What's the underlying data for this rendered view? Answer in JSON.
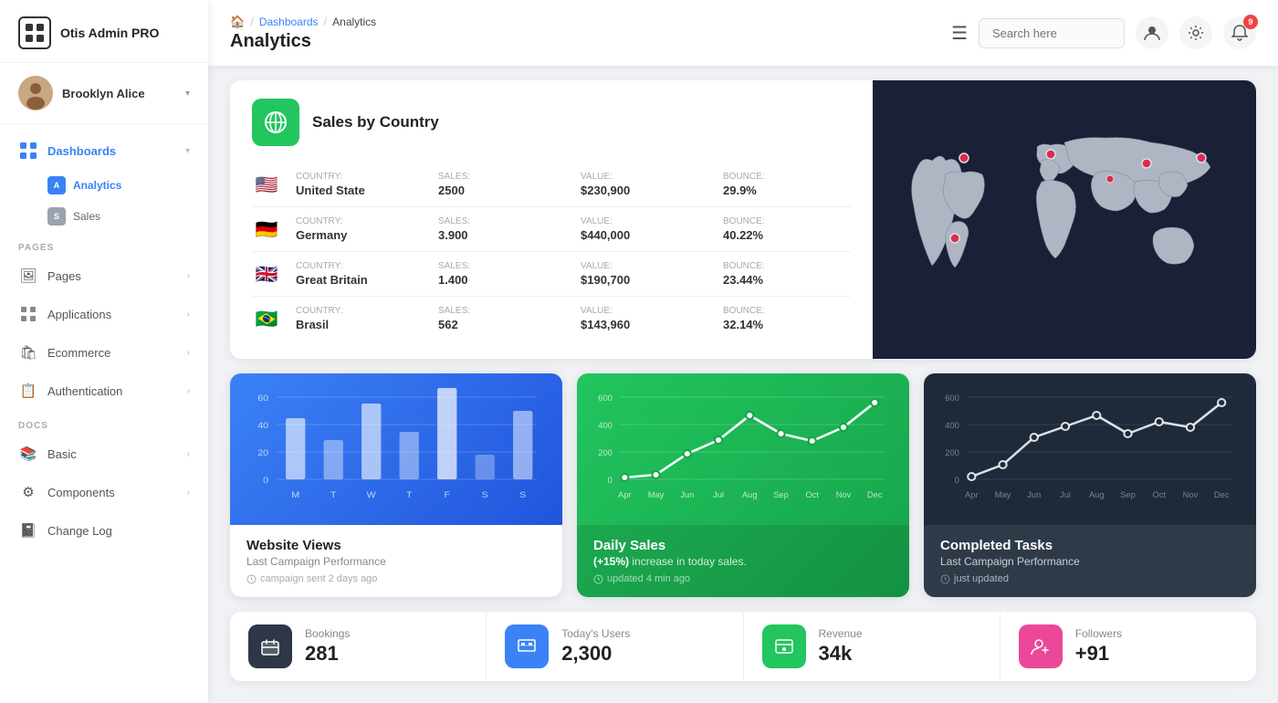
{
  "app": {
    "name": "Otis Admin PRO"
  },
  "user": {
    "name": "Brooklyn Alice"
  },
  "header": {
    "breadcrumb": {
      "home": "🏠",
      "separator1": "/",
      "dashboards": "Dashboards",
      "separator2": "/",
      "current": "Analytics"
    },
    "title": "Analytics",
    "menu_icon": "☰",
    "search_placeholder": "Search here",
    "notification_count": "9"
  },
  "sidebar": {
    "sections": [
      {
        "label": null,
        "items": [
          {
            "id": "dashboards",
            "label": "Dashboards",
            "icon": "⊞",
            "expanded": true,
            "children": [
              {
                "id": "analytics",
                "label": "Analytics",
                "badge": "A",
                "active": true
              },
              {
                "id": "sales",
                "label": "Sales",
                "badge": "S",
                "active": false
              }
            ]
          }
        ]
      },
      {
        "label": "PAGES",
        "items": [
          {
            "id": "pages",
            "label": "Pages",
            "icon": "🖼"
          },
          {
            "id": "applications",
            "label": "Applications",
            "icon": "⬛"
          },
          {
            "id": "ecommerce",
            "label": "Ecommerce",
            "icon": "🛍"
          },
          {
            "id": "authentication",
            "label": "Authentication",
            "icon": "📋"
          }
        ]
      },
      {
        "label": "DOCS",
        "items": [
          {
            "id": "basic",
            "label": "Basic",
            "icon": "📚"
          },
          {
            "id": "components",
            "label": "Components",
            "icon": "⚙"
          },
          {
            "id": "changelog",
            "label": "Change Log",
            "icon": "📓"
          }
        ]
      }
    ]
  },
  "sales_by_country": {
    "title": "Sales by Country",
    "countries": [
      {
        "flag": "🇺🇸",
        "country_label": "Country:",
        "country_value": "United State",
        "sales_label": "Sales:",
        "sales_value": "2500",
        "value_label": "Value:",
        "value_value": "$230,900",
        "bounce_label": "Bounce:",
        "bounce_value": "29.9%"
      },
      {
        "flag": "🇩🇪",
        "country_label": "Country:",
        "country_value": "Germany",
        "sales_label": "Sales:",
        "sales_value": "3.900",
        "value_label": "Value:",
        "value_value": "$440,000",
        "bounce_label": "Bounce:",
        "bounce_value": "40.22%"
      },
      {
        "flag": "🇬🇧",
        "country_label": "Country:",
        "country_value": "Great Britain",
        "sales_label": "Sales:",
        "sales_value": "1.400",
        "value_label": "Value:",
        "value_value": "$190,700",
        "bounce_label": "Bounce:",
        "bounce_value": "23.44%"
      },
      {
        "flag": "🇧🇷",
        "country_label": "Country:",
        "country_value": "Brasil",
        "sales_label": "Sales:",
        "sales_value": "562",
        "value_label": "Value:",
        "value_value": "$143,960",
        "bounce_label": "Bounce:",
        "bounce_value": "32.14%"
      }
    ]
  },
  "charts": {
    "website_views": {
      "title": "Website Views",
      "subtitle": "Last Campaign Performance",
      "meta": "campaign sent 2 days ago",
      "y_labels": [
        "60",
        "40",
        "20",
        "0"
      ],
      "x_labels": [
        "M",
        "T",
        "W",
        "T",
        "F",
        "S",
        "S"
      ],
      "bars": [
        40,
        25,
        50,
        30,
        60,
        15,
        45
      ]
    },
    "daily_sales": {
      "title": "Daily Sales",
      "subtitle_prefix": "",
      "highlight": "(+15%)",
      "subtitle_suffix": "increase in today sales.",
      "meta": "updated 4 min ago",
      "y_labels": [
        "600",
        "400",
        "200",
        "0"
      ],
      "x_labels": [
        "Apr",
        "May",
        "Jun",
        "Jul",
        "Aug",
        "Sep",
        "Oct",
        "Nov",
        "Dec"
      ],
      "points": [
        10,
        50,
        180,
        280,
        420,
        300,
        250,
        350,
        500
      ]
    },
    "completed_tasks": {
      "title": "Completed Tasks",
      "subtitle": "Last Campaign Performance",
      "meta": "just updated",
      "y_labels": [
        "600",
        "400",
        "200",
        "0"
      ],
      "x_labels": [
        "Apr",
        "May",
        "Jun",
        "Jul",
        "Aug",
        "Sep",
        "Oct",
        "Nov",
        "Dec"
      ],
      "points": [
        20,
        100,
        280,
        350,
        420,
        300,
        380,
        340,
        500
      ]
    }
  },
  "stats": [
    {
      "icon": "🪑",
      "icon_class": "dark",
      "label": "Bookings",
      "value": "281"
    },
    {
      "icon": "📊",
      "icon_class": "blue",
      "label": "Today's Users",
      "value": "2,300"
    },
    {
      "icon": "🏪",
      "icon_class": "green",
      "label": "Revenue",
      "value": "34k"
    },
    {
      "icon": "👤",
      "icon_class": "pink",
      "label": "Followers",
      "value": "+91"
    }
  ]
}
